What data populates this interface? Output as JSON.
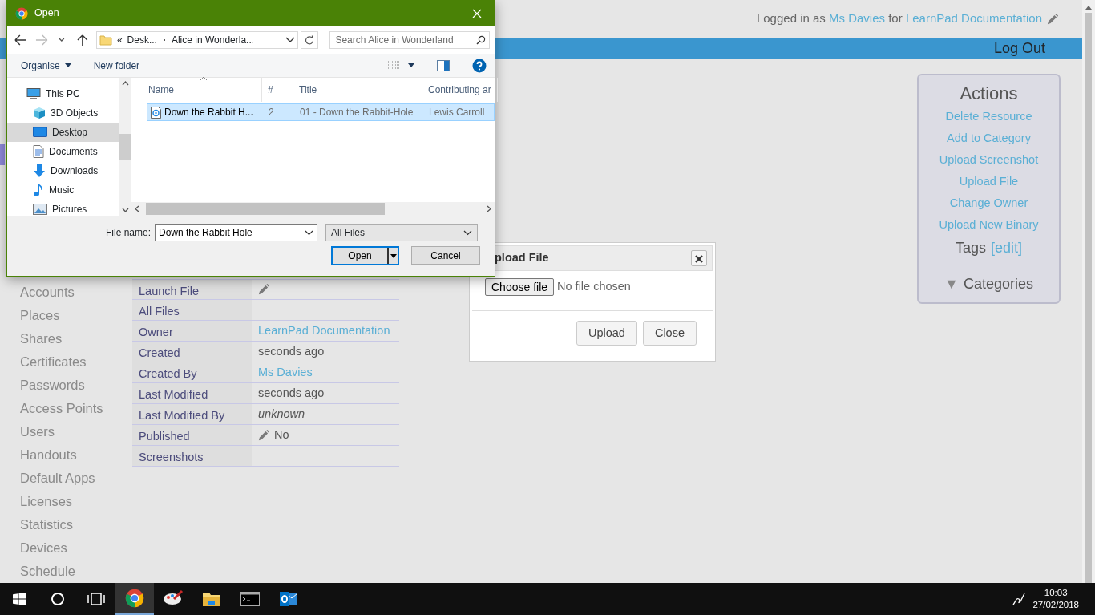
{
  "header": {
    "prefix": "Logged in as",
    "user": "Ms Davies",
    "joiner": "for",
    "org": "LearnPad Documentation"
  },
  "nav_bar": {
    "logout": "Log Out"
  },
  "sidebar": {
    "items": [
      "Accounts",
      "Places",
      "Shares",
      "Certificates",
      "Passwords",
      "Access Points",
      "Users",
      "Handouts",
      "Default Apps",
      "Licenses",
      "Statistics",
      "Devices",
      "Schedule"
    ]
  },
  "details": {
    "rows": [
      {
        "label": "Launch File",
        "kind": "edit"
      },
      {
        "label": "All Files",
        "kind": "empty"
      },
      {
        "label": "Owner",
        "kind": "link",
        "value": "LearnPad Documentation"
      },
      {
        "label": "Created",
        "kind": "text",
        "value": "seconds ago"
      },
      {
        "label": "Created By",
        "kind": "link",
        "value": "Ms Davies"
      },
      {
        "label": "Last Modified",
        "kind": "text",
        "value": "seconds ago"
      },
      {
        "label": "Last Modified By",
        "kind": "italic",
        "value": "unknown"
      },
      {
        "label": "Published",
        "kind": "edit",
        "value": "No"
      },
      {
        "label": "Screenshots",
        "kind": "empty"
      }
    ]
  },
  "actions_panel": {
    "title": "Actions",
    "links": [
      "Delete Resource",
      "Add to Category",
      "Upload Screenshot",
      "Upload File",
      "Change Owner",
      "Upload New Binary"
    ],
    "tags_label": "Tags",
    "tags_edit": "[edit]",
    "categories_toggle": "▼",
    "categories_label": "Categories"
  },
  "upload_modal": {
    "title": "pload File",
    "choose_button": "Choose file",
    "file_status": "No file chosen",
    "buttons": [
      "Upload",
      "Close"
    ]
  },
  "open_dialog": {
    "title": "Open",
    "address": {
      "overflow": "«",
      "segments": [
        "Desk...",
        "Alice in Wonderla..."
      ]
    },
    "search": {
      "placeholder": "Search Alice in Wonderland"
    },
    "toolbar": {
      "organise": "Organise",
      "new_folder": "New folder"
    },
    "nav_items": [
      {
        "label": "This PC",
        "kind": "pc",
        "selected": false
      },
      {
        "label": "3D Objects",
        "kind": "cube",
        "selected": false
      },
      {
        "label": "Desktop",
        "kind": "desktop",
        "selected": true
      },
      {
        "label": "Documents",
        "kind": "documents",
        "selected": false
      },
      {
        "label": "Downloads",
        "kind": "downloads",
        "selected": false
      },
      {
        "label": "Music",
        "kind": "music",
        "selected": false
      },
      {
        "label": "Pictures",
        "kind": "pictures",
        "selected": false
      }
    ],
    "columns": [
      "Name",
      "#",
      "Title",
      "Contributing ar"
    ],
    "files": [
      {
        "name": "Down the Rabbit H...",
        "number": "2",
        "title": "01 - Down the Rabbit-Hole",
        "artist": "Lewis Carroll",
        "selected": true
      }
    ],
    "file_name": {
      "label": "File name:",
      "value": "Down the Rabbit Hole"
    },
    "file_type": "All Files",
    "buttons": {
      "open": "Open",
      "cancel": "Cancel"
    }
  },
  "taskbar": {
    "items": [
      {
        "kind": "start",
        "selected": false
      },
      {
        "kind": "cortana",
        "selected": false
      },
      {
        "kind": "taskview",
        "selected": false
      },
      {
        "kind": "chrome",
        "selected": true
      },
      {
        "kind": "paint",
        "selected": false
      },
      {
        "kind": "explorer",
        "selected": false
      },
      {
        "kind": "terminal",
        "selected": false
      },
      {
        "kind": "outlook",
        "selected": false
      }
    ],
    "clock": {
      "time": "10:03",
      "date": "27/02/2018"
    }
  }
}
